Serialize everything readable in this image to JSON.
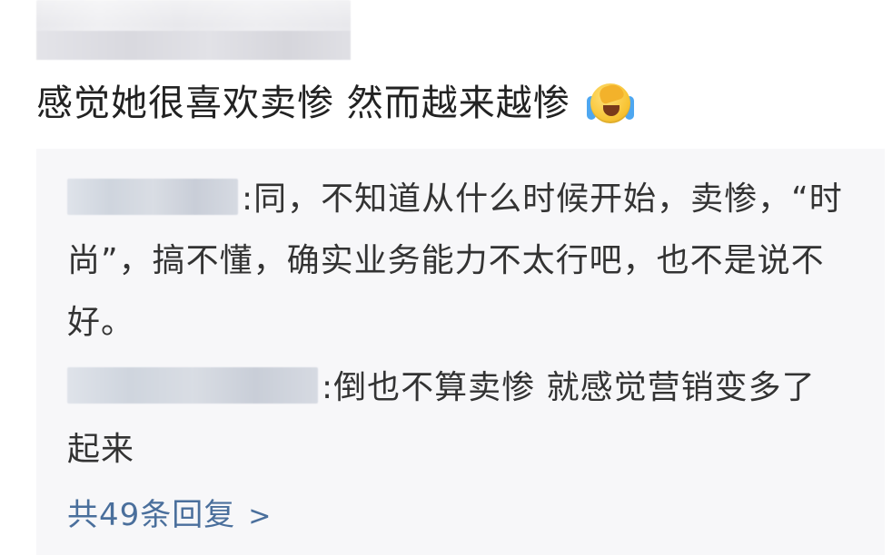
{
  "post": {
    "comment_text": "感觉她很喜欢卖惨 然而越来越惨",
    "emoji": "laughing-crying-face-icon"
  },
  "replies": [
    {
      "separator": ":",
      "text": "同，不知道从什么时候开始，卖惨，“时尚”，搞不懂，确实业务能力不太行吧，也不是说不好。"
    },
    {
      "separator": ":",
      "text": "倒也不算卖惨 就感觉营销变多了起来"
    }
  ],
  "more": {
    "label": "共49条回复",
    "chevron": ">"
  },
  "colors": {
    "link": "#4a6f9c",
    "reply_bg": "#f7f7f9",
    "text": "#333333"
  }
}
